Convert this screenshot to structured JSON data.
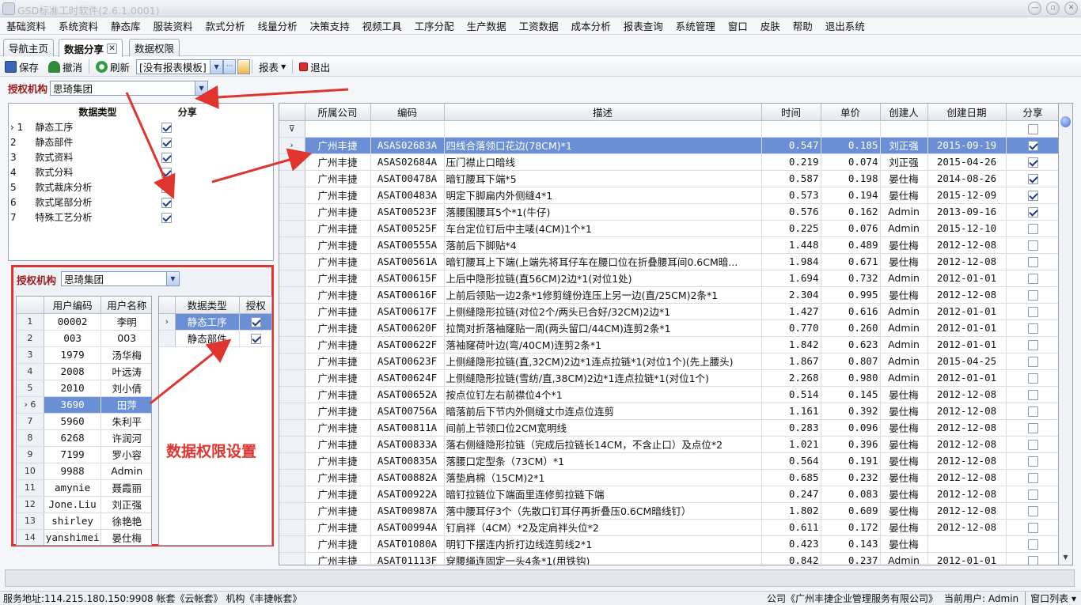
{
  "window": {
    "title": "GSD标准工时软件(2.6.1.0001)",
    "buttons": [
      "—",
      "▫",
      "✕"
    ]
  },
  "menu": [
    "基础资料",
    "系统资料",
    "静态库",
    "服装资料",
    "款式分析",
    "线量分析",
    "决策支持",
    "视频工具",
    "工序分配",
    "生产数据",
    "工资数据",
    "成本分析",
    "报表查询",
    "系统管理",
    "窗口",
    "皮肤",
    "帮助",
    "退出系统"
  ],
  "tabs": [
    {
      "label": "导航主页"
    },
    {
      "label": "数据分享",
      "close": "✕"
    },
    {
      "label": "数据权限"
    }
  ],
  "toolbar": {
    "save": "保存",
    "undo": "撤消",
    "refresh": "刷新",
    "template": "[没有报表模板]",
    "more": "···",
    "report": "报表",
    "exit": "退出"
  },
  "org": {
    "label": "授权机构",
    "value": "思琦集团"
  },
  "data_types": {
    "headers": [
      "数据类型",
      "分享"
    ],
    "rows": [
      {
        "n": "1",
        "name": "静态工序",
        "share": true,
        "sel": true
      },
      {
        "n": "2",
        "name": "静态部件",
        "share": true
      },
      {
        "n": "3",
        "name": "款式资料",
        "share": true
      },
      {
        "n": "4",
        "name": "款式分料",
        "share": true
      },
      {
        "n": "5",
        "name": "款式裁床分析",
        "share": true
      },
      {
        "n": "6",
        "name": "款式尾部分析",
        "share": true
      },
      {
        "n": "7",
        "name": "特殊工艺分析",
        "share": true
      }
    ]
  },
  "perm": {
    "org_label": "授权机构",
    "org_value": "思琦集团",
    "user_headers": [
      "用户编码",
      "用户名称"
    ],
    "users": [
      {
        "n": "1",
        "code": "00002",
        "name": "李明"
      },
      {
        "n": "2",
        "code": "003",
        "name": "003"
      },
      {
        "n": "3",
        "code": "1979",
        "name": "汤华梅"
      },
      {
        "n": "4",
        "code": "2008",
        "name": "叶远涛"
      },
      {
        "n": "5",
        "code": "2010",
        "name": "刘小倩"
      },
      {
        "n": "6",
        "code": "3690",
        "name": "田萍",
        "sel": true
      },
      {
        "n": "7",
        "code": "5960",
        "name": "朱利平"
      },
      {
        "n": "8",
        "code": "6268",
        "name": "许润河"
      },
      {
        "n": "9",
        "code": "7199",
        "name": "罗小容"
      },
      {
        "n": "10",
        "code": "9988",
        "name": "Admin"
      },
      {
        "n": "11",
        "code": "amynie",
        "name": "聂霞丽"
      },
      {
        "n": "12",
        "code": "Jone.Liu",
        "name": "刘正强"
      },
      {
        "n": "13",
        "code": "shirley",
        "name": "徐艳艳"
      },
      {
        "n": "14",
        "code": "yanshimei",
        "name": "晏仕梅"
      }
    ],
    "auth_headers": [
      "数据类型",
      "授权"
    ],
    "auth": [
      {
        "name": "静态工序",
        "on": true,
        "sel": true
      },
      {
        "name": "静态部件",
        "on": true
      }
    ],
    "caption": "数据权限设置"
  },
  "main": {
    "headers": [
      "所属公司",
      "编码",
      "描述",
      "时间",
      "单价",
      "创建人",
      "创建日期",
      "分享"
    ],
    "filter_icon": "funnel-icon",
    "rows": [
      [
        "广州丰捷",
        "ASAS02683A",
        "四线合落领口花边(78CM)*1",
        "0.547",
        "0.185",
        "刘正强",
        "2015-09-19",
        true
      ],
      [
        "广州丰捷",
        "ASAS02684A",
        "压门襟止口暗线",
        "0.219",
        "0.074",
        "刘正强",
        "2015-04-26",
        true
      ],
      [
        "广州丰捷",
        "ASAT00478A",
        "暗钉腰耳下端*5",
        "0.587",
        "0.198",
        "晏仕梅",
        "2014-08-26",
        true
      ],
      [
        "广州丰捷",
        "ASAT00483A",
        "明定下脚扁内外侧缝4*1",
        "0.573",
        "0.194",
        "晏仕梅",
        "2015-12-09",
        true
      ],
      [
        "广州丰捷",
        "ASAT00523F",
        "落腰围腰耳5个*1(牛仔)",
        "0.576",
        "0.162",
        "Admin",
        "2013-09-16",
        true
      ],
      [
        "广州丰捷",
        "ASAT00525F",
        "车台定位钉后中主唛(4CM)1个*1",
        "0.225",
        "0.076",
        "Admin",
        "2015-12-10",
        false
      ],
      [
        "广州丰捷",
        "ASAT00555A",
        "落前后下脚贴*4",
        "1.448",
        "0.489",
        "晏仕梅",
        "2012-12-08",
        false
      ],
      [
        "广州丰捷",
        "ASAT00561A",
        "暗钉腰耳上下端(上端先将耳仔车在腰口位在折叠腰耳间0.6CM暗...",
        "1.984",
        "0.671",
        "晏仕梅",
        "2012-12-08",
        false
      ],
      [
        "广州丰捷",
        "ASAT00615F",
        "上后中隐形拉链(直56CM)2边*1(对位1处)",
        "1.694",
        "0.732",
        "Admin",
        "2012-01-01",
        false
      ],
      [
        "广州丰捷",
        "ASAT00616F",
        "上前后领贴一边2条*1修剪缝份连压上另一边(直/25CM)2条*1",
        "2.304",
        "0.995",
        "晏仕梅",
        "2012-12-08",
        false
      ],
      [
        "广州丰捷",
        "ASAT00617F",
        "上侧缝隐形拉链(对位2个/两头已合好/32CM)2边*1",
        "1.427",
        "0.616",
        "Admin",
        "2012-01-01",
        false
      ],
      [
        "广州丰捷",
        "ASAT00620F",
        "拉筒对折落袖窿贴一周(两头留口/44CM)连剪2条*1",
        "0.770",
        "0.260",
        "Admin",
        "2012-01-01",
        false
      ],
      [
        "广州丰捷",
        "ASAT00622F",
        "落袖窿荷叶边(弯/40CM)连剪2条*1",
        "1.842",
        "0.623",
        "Admin",
        "2012-01-01",
        false
      ],
      [
        "广州丰捷",
        "ASAT00623F",
        "上侧缝隐形拉链(直,32CM)2边*1连点拉链*1(对位1个)(先上腰头)",
        "1.867",
        "0.807",
        "Admin",
        "2015-04-25",
        false
      ],
      [
        "广州丰捷",
        "ASAT00624F",
        "上侧缝隐形拉链(雪纺/直,38CM)2边*1连点拉链*1(对位1个)",
        "2.268",
        "0.980",
        "Admin",
        "2012-01-01",
        false
      ],
      [
        "广州丰捷",
        "ASAT00652A",
        "按点位钉左右前襟位4个*1",
        "0.514",
        "0.145",
        "晏仕梅",
        "2012-12-08",
        false
      ],
      [
        "广州丰捷",
        "ASAT00756A",
        "暗落前后下节内外侧缝丈巾连点位连剪",
        "1.161",
        "0.392",
        "晏仕梅",
        "2012-12-08",
        false
      ],
      [
        "广州丰捷",
        "ASAT00811A",
        "间前上节领口位2CM宽明线",
        "0.283",
        "0.096",
        "晏仕梅",
        "2012-12-08",
        false
      ],
      [
        "广州丰捷",
        "ASAT00833A",
        "落右侧缝隐形拉链（完成后拉链长14CM，不含止口）及点位*2",
        "1.021",
        "0.396",
        "晏仕梅",
        "2012-12-08",
        false
      ],
      [
        "广州丰捷",
        "ASAT00835A",
        "落腰口定型条（73CM）*1",
        "0.564",
        "0.191",
        "晏仕梅",
        "2012-12-08",
        false
      ],
      [
        "广州丰捷",
        "ASAT00882A",
        "落垫肩棉（15CM)2*1",
        "0.685",
        "0.232",
        "晏仕梅",
        "2012-12-08",
        false
      ],
      [
        "广州丰捷",
        "ASAT00922A",
        "暗钉拉链位下端面里连修剪拉链下端",
        "0.247",
        "0.083",
        "晏仕梅",
        "2012-12-08",
        false
      ],
      [
        "广州丰捷",
        "ASAT00987A",
        "落中腰耳仔3个（先散口钉耳仔再折叠压0.6CM暗线钉）",
        "1.802",
        "0.609",
        "晏仕梅",
        "2012-12-08",
        false
      ],
      [
        "广州丰捷",
        "ASAT00994A",
        "钉肩袢（4CM）*2及定肩袢头位*2",
        "0.611",
        "0.172",
        "晏仕梅",
        "2012-12-08",
        false
      ],
      [
        "广州丰捷",
        "ASAT01080A",
        "明钉下摆连内折打边线连剪线2*1",
        "0.423",
        "0.143",
        "晏仕梅",
        "",
        false
      ],
      [
        "广州丰捷",
        "ASAT01113F",
        "穿腰绳连固定一头4条*1(用铁钩)",
        "0.842",
        "0.237",
        "Admin",
        "2012-01-01",
        false
      ]
    ]
  },
  "status": {
    "left": "服务地址:114.215.180.150:9908   帐套《云帐套》 机构《丰捷帐套》",
    "company": "公司《广州丰捷企业管理服务有限公司》",
    "user": "当前用户: Admin",
    "winlist": "窗口列表 ▾"
  },
  "colors": {
    "selection": "#6b8fd6",
    "annotation": "#e0352f",
    "label_red": "#9b1c1c"
  }
}
